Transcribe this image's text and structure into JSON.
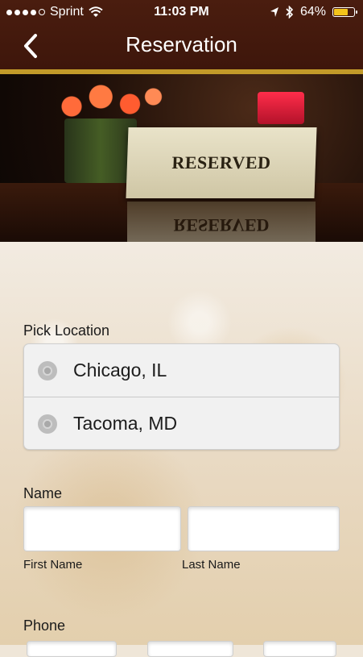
{
  "status_bar": {
    "carrier": "Sprint",
    "time": "11:03 PM",
    "battery": "64%",
    "battery_level": 0.64,
    "icons": [
      "signal-dots-icon",
      "wifi-icon",
      "location-arrow-icon",
      "bluetooth-icon",
      "battery-icon"
    ]
  },
  "header": {
    "title": "Reservation",
    "back_icon": "chevron-left-icon"
  },
  "hero": {
    "sign_text": "RESERVED",
    "reflection_text": "RESERVED"
  },
  "form": {
    "location_label": "Pick Location",
    "locations": [
      {
        "label": "Chicago, IL",
        "selected": false
      },
      {
        "label": "Tacoma, MD",
        "selected": false
      }
    ],
    "name_label": "Name",
    "first_name": {
      "value": "",
      "caption": "First Name"
    },
    "last_name": {
      "value": "",
      "caption": "Last Name"
    },
    "phone_label": "Phone"
  },
  "colors": {
    "header_bg": "#3e160b",
    "accent_gold": "#c29a29",
    "battery_fill": "#f3c41b"
  }
}
